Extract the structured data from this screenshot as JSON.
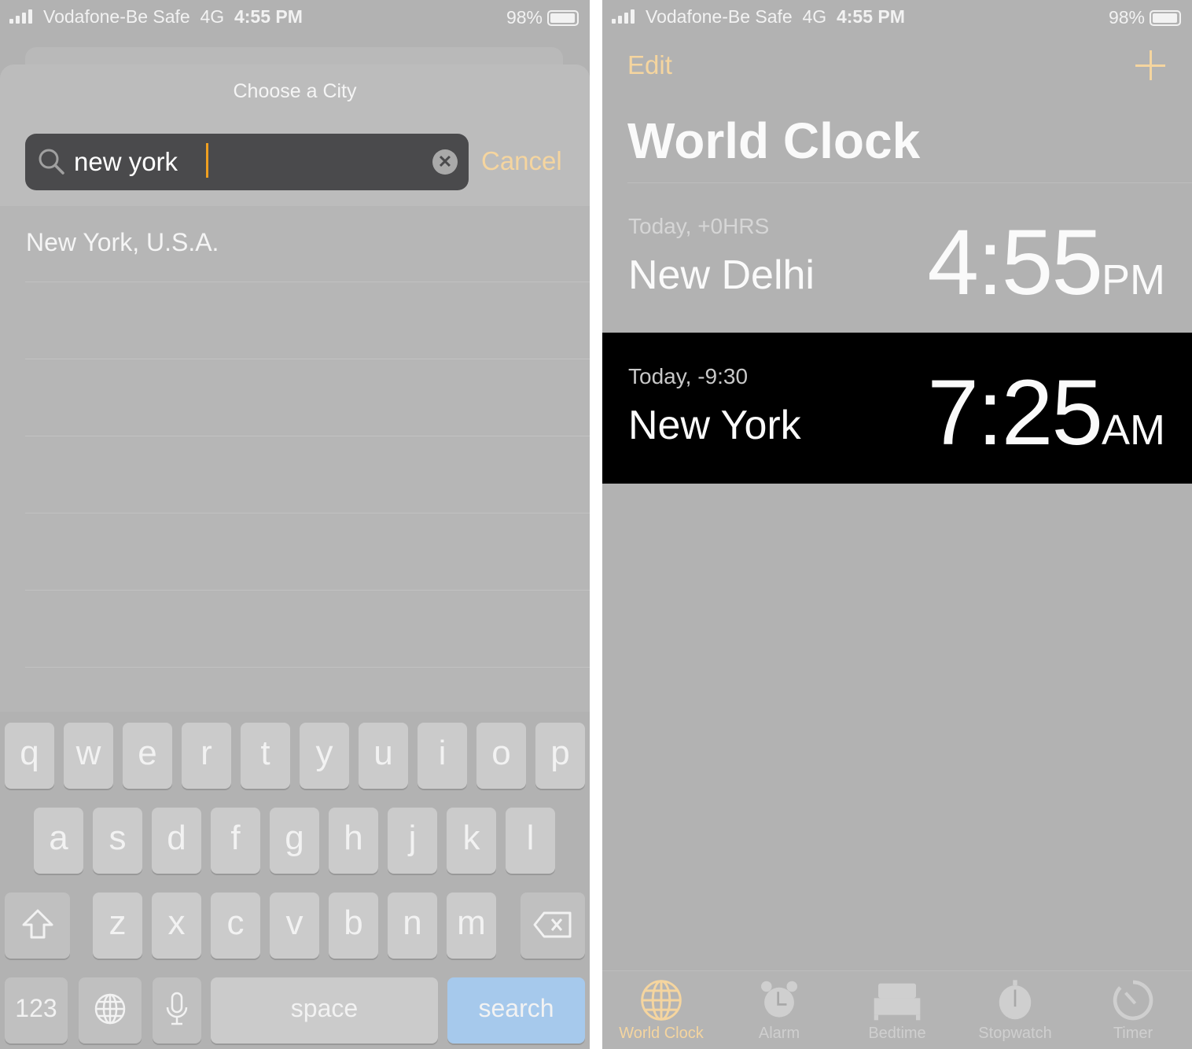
{
  "status_bar": {
    "carrier": "Vodafone-Be Safe",
    "network": "4G",
    "time": "4:55 PM",
    "battery": "98%",
    "battery_level": 0.98
  },
  "colors": {
    "accent": "#f5d59f",
    "background": "#b2b2b2",
    "selected_row": "#000000",
    "search_key": "#a6c9ec",
    "caret": "#f0a020"
  },
  "city_picker": {
    "title": "Choose a City",
    "search": {
      "value": "new york",
      "icon": "search-icon",
      "clear_icon": "clear-icon"
    },
    "cancel_label": "Cancel",
    "results": [
      "New York, U.S.A."
    ]
  },
  "keyboard": {
    "row1": [
      "q",
      "w",
      "e",
      "r",
      "t",
      "y",
      "u",
      "i",
      "o",
      "p"
    ],
    "row2": [
      "a",
      "s",
      "d",
      "f",
      "g",
      "h",
      "j",
      "k",
      "l"
    ],
    "row3": [
      "z",
      "x",
      "c",
      "v",
      "b",
      "n",
      "m"
    ],
    "shift_icon": "shift-icon",
    "delete_icon": "backspace-icon",
    "numbers_label": "123",
    "globe_icon": "globe-icon",
    "mic_icon": "microphone-icon",
    "space_label": "space",
    "search_label": "search"
  },
  "world_clock": {
    "edit_label": "Edit",
    "add_icon": "plus-icon",
    "title": "World Clock",
    "clocks": [
      {
        "offset": "Today, +0HRS",
        "city": "New Delhi",
        "time": "4:55",
        "ampm": "PM",
        "selected": false
      },
      {
        "offset": "Today, -9:30",
        "city": "New York",
        "time": "7:25",
        "ampm": "AM",
        "selected": true
      }
    ],
    "tabs": [
      {
        "label": "World Clock",
        "icon": "globe-icon",
        "active": true
      },
      {
        "label": "Alarm",
        "icon": "alarm-clock-icon",
        "active": false
      },
      {
        "label": "Bedtime",
        "icon": "bed-icon",
        "active": false
      },
      {
        "label": "Stopwatch",
        "icon": "stopwatch-icon",
        "active": false
      },
      {
        "label": "Timer",
        "icon": "timer-icon",
        "active": false
      }
    ]
  }
}
